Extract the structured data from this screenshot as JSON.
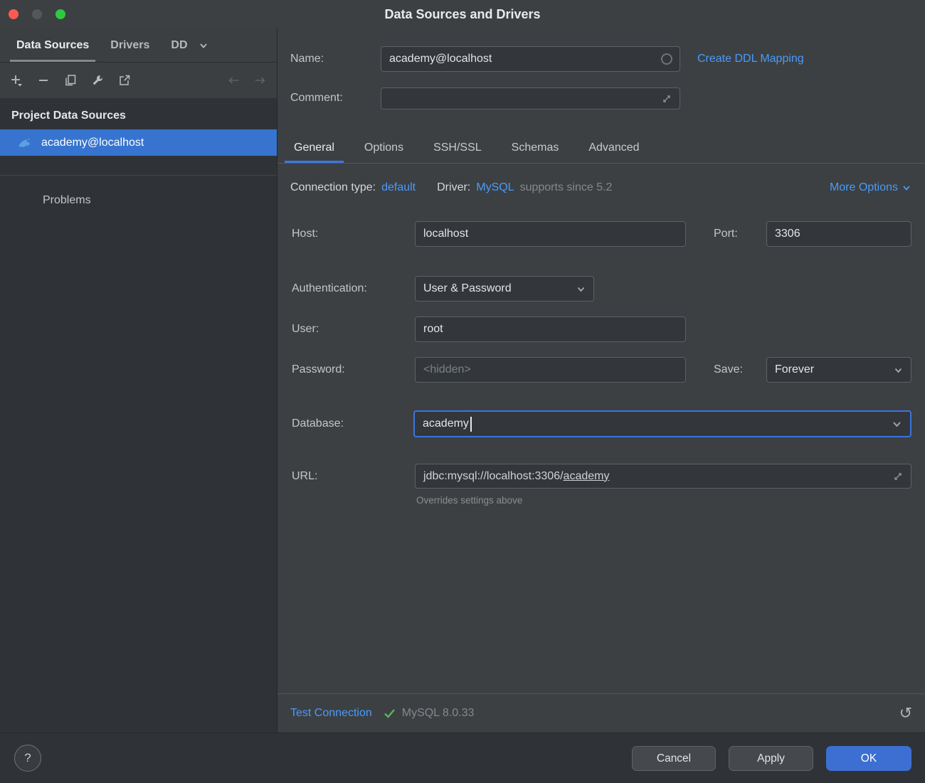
{
  "window": {
    "title": "Data Sources and Drivers"
  },
  "sidebar": {
    "tabs": [
      {
        "label": "Data Sources"
      },
      {
        "label": "Drivers"
      },
      {
        "label": "DD"
      }
    ],
    "section_title": "Project Data Sources",
    "selected_item": "academy@localhost",
    "problems": "Problems"
  },
  "header": {
    "name_label": "Name:",
    "name_value": "academy@localhost",
    "ddl_link": "Create DDL Mapping",
    "comment_label": "Comment:",
    "comment_value": ""
  },
  "tabs": {
    "general": "General",
    "options": "Options",
    "ssh": "SSH/SSL",
    "schemas": "Schemas",
    "advanced": "Advanced"
  },
  "connection": {
    "type_label": "Connection type:",
    "type_value": "default",
    "driver_label": "Driver:",
    "driver_value": "MySQL",
    "driver_note": "supports since 5.2",
    "more_options": "More Options"
  },
  "form": {
    "host_label": "Host:",
    "host_value": "localhost",
    "port_label": "Port:",
    "port_value": "3306",
    "auth_label": "Authentication:",
    "auth_value": "User & Password",
    "user_label": "User:",
    "user_value": "root",
    "password_label": "Password:",
    "password_placeholder": "<hidden>",
    "save_label": "Save:",
    "save_value": "Forever",
    "database_label": "Database:",
    "database_value": "academy",
    "url_label": "URL:",
    "url_prefix": "jdbc:mysql://localhost:3306/",
    "url_database": "academy",
    "url_note": "Overrides settings above"
  },
  "status": {
    "test_connection": "Test Connection",
    "result": "MySQL 8.0.33"
  },
  "footer": {
    "help": "?",
    "cancel": "Cancel",
    "apply": "Apply",
    "ok": "OK"
  },
  "colors": {
    "accent": "#3b74e0",
    "link": "#4a9af8",
    "selection": "#3674d0",
    "success": "#5bb65a"
  }
}
